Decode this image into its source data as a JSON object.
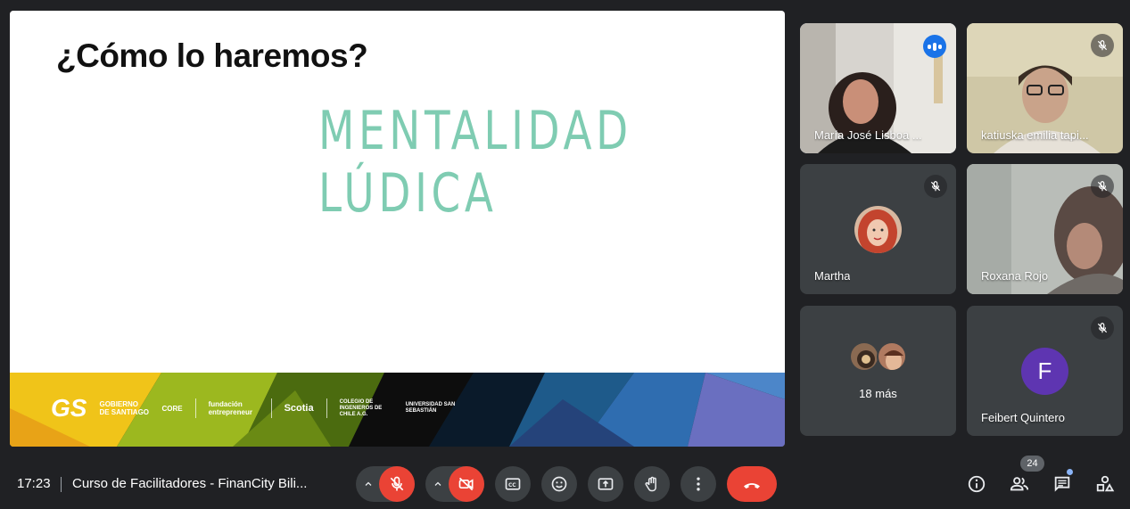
{
  "slide": {
    "title": "¿Cómo lo haremos?",
    "subtitle": "MENTALIDAD LÚDICA",
    "logos": {
      "gs": "GS",
      "gobierno": "GOBIERNO DE SANTIAGO",
      "core": "CORE",
      "fundacion": "fundación entrepreneur",
      "scotia": "Scotia",
      "colegio": "COLEGIO DE INGENIEROS DE CHILE A.G.",
      "universidad": "UNIVERSIDAD SAN SEBASTIÁN"
    }
  },
  "participants": [
    {
      "name": "María José Lisboa ...",
      "state": "speaking"
    },
    {
      "name": "katiuska emilia tapi...",
      "state": "muted"
    },
    {
      "name": "Martha",
      "state": "muted"
    },
    {
      "name": "Roxana Rojo",
      "state": "muted"
    },
    {
      "name": "18 más",
      "state": "group"
    },
    {
      "name": "Feibert Quintero",
      "initial": "F",
      "state": "muted"
    }
  ],
  "toolbar": {
    "time": "17:23",
    "meeting_title": "Curso de Facilitadores - FinanCity Bili...",
    "participant_count": "24"
  },
  "icons": [
    "chevron-up-icon",
    "mic-off-icon",
    "camera-off-icon",
    "captions-icon",
    "emoji-icon",
    "present-icon",
    "raise-hand-icon",
    "more-vert-icon",
    "hangup-icon",
    "info-icon",
    "people-icon",
    "chat-icon",
    "activities-icon"
  ],
  "colors": {
    "background": "#202124",
    "tile": "#3c4043",
    "danger": "#ea4335",
    "accent": "#1a73e8",
    "subtitle": "#7fccb2",
    "avatar_f": "#5e35b1"
  }
}
